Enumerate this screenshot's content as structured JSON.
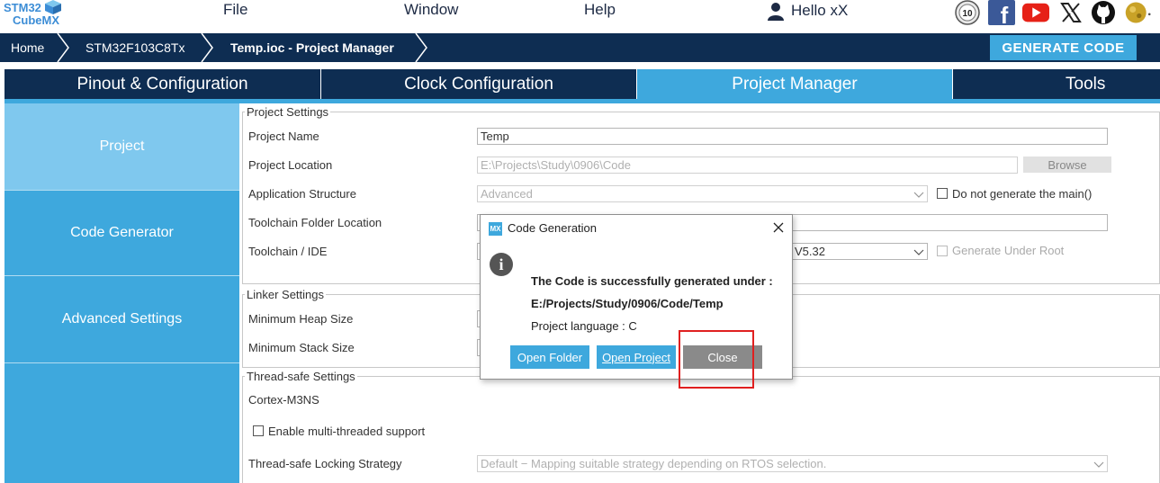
{
  "app": {
    "logo_line1": "STM32",
    "logo_line2": "CubeMX",
    "logo_icon": "cube-icon"
  },
  "menu": {
    "file": "File",
    "window": "Window",
    "help": "Help",
    "user": "Hello xX"
  },
  "social_icons": [
    "anniversary-10-icon",
    "facebook-icon",
    "youtube-icon",
    "x-twitter-icon",
    "github-icon",
    "st-community-icon"
  ],
  "breadcrumb": {
    "home": "Home",
    "device": "STM32F103C8Tx",
    "current": "Temp.ioc - Project Manager"
  },
  "generate_button": "GENERATE CODE",
  "tabs": [
    {
      "label": "Pinout & Configuration"
    },
    {
      "label": "Clock Configuration"
    },
    {
      "label": "Project Manager"
    },
    {
      "label": "Tools"
    }
  ],
  "sidebar": {
    "items": [
      {
        "label": "Project"
      },
      {
        "label": "Code Generator"
      },
      {
        "label": "Advanced Settings"
      }
    ]
  },
  "project_settings": {
    "legend": "Project Settings",
    "project_name_label": "Project Name",
    "project_name_value": "Temp",
    "project_location_label": "Project Location",
    "project_location_value": "E:\\Projects\\Study\\0906\\Code",
    "browse_label": "Browse",
    "app_structure_label": "Application Structure",
    "app_structure_value": "Advanced",
    "no_main_label": "Do not generate the main()",
    "toolchain_folder_label": "Toolchain Folder Location",
    "toolchain_ide_label": "Toolchain / IDE",
    "toolchain_ide_value": "V5.32",
    "generate_under_root_label": "Generate Under Root"
  },
  "linker_settings": {
    "legend": "Linker Settings",
    "heap_label": "Minimum Heap Size",
    "stack_label": "Minimum Stack Size"
  },
  "thread_safe": {
    "legend": "Thread-safe Settings",
    "core": "Cortex-M3NS",
    "multithread_label": "Enable multi-threaded support",
    "locking_label": "Thread-safe Locking Strategy",
    "locking_value": "Default  −  Mapping suitable strategy depending on RTOS selection."
  },
  "dialog": {
    "badge": "MX",
    "title": "Code Generation",
    "message_line1": "The Code is successfully generated under :",
    "message_line2": "E:/Projects/Study/0906/Code/Temp",
    "language": "Project language : C",
    "open_folder": "Open Folder",
    "open_project": "Open Project",
    "close": "Close"
  },
  "colors": {
    "navy": "#0e2d52",
    "accent": "#3ea8dd",
    "sidebar_active": "#7fc8ee",
    "close_button": "#8a8a8a",
    "highlight": "#e02020"
  }
}
